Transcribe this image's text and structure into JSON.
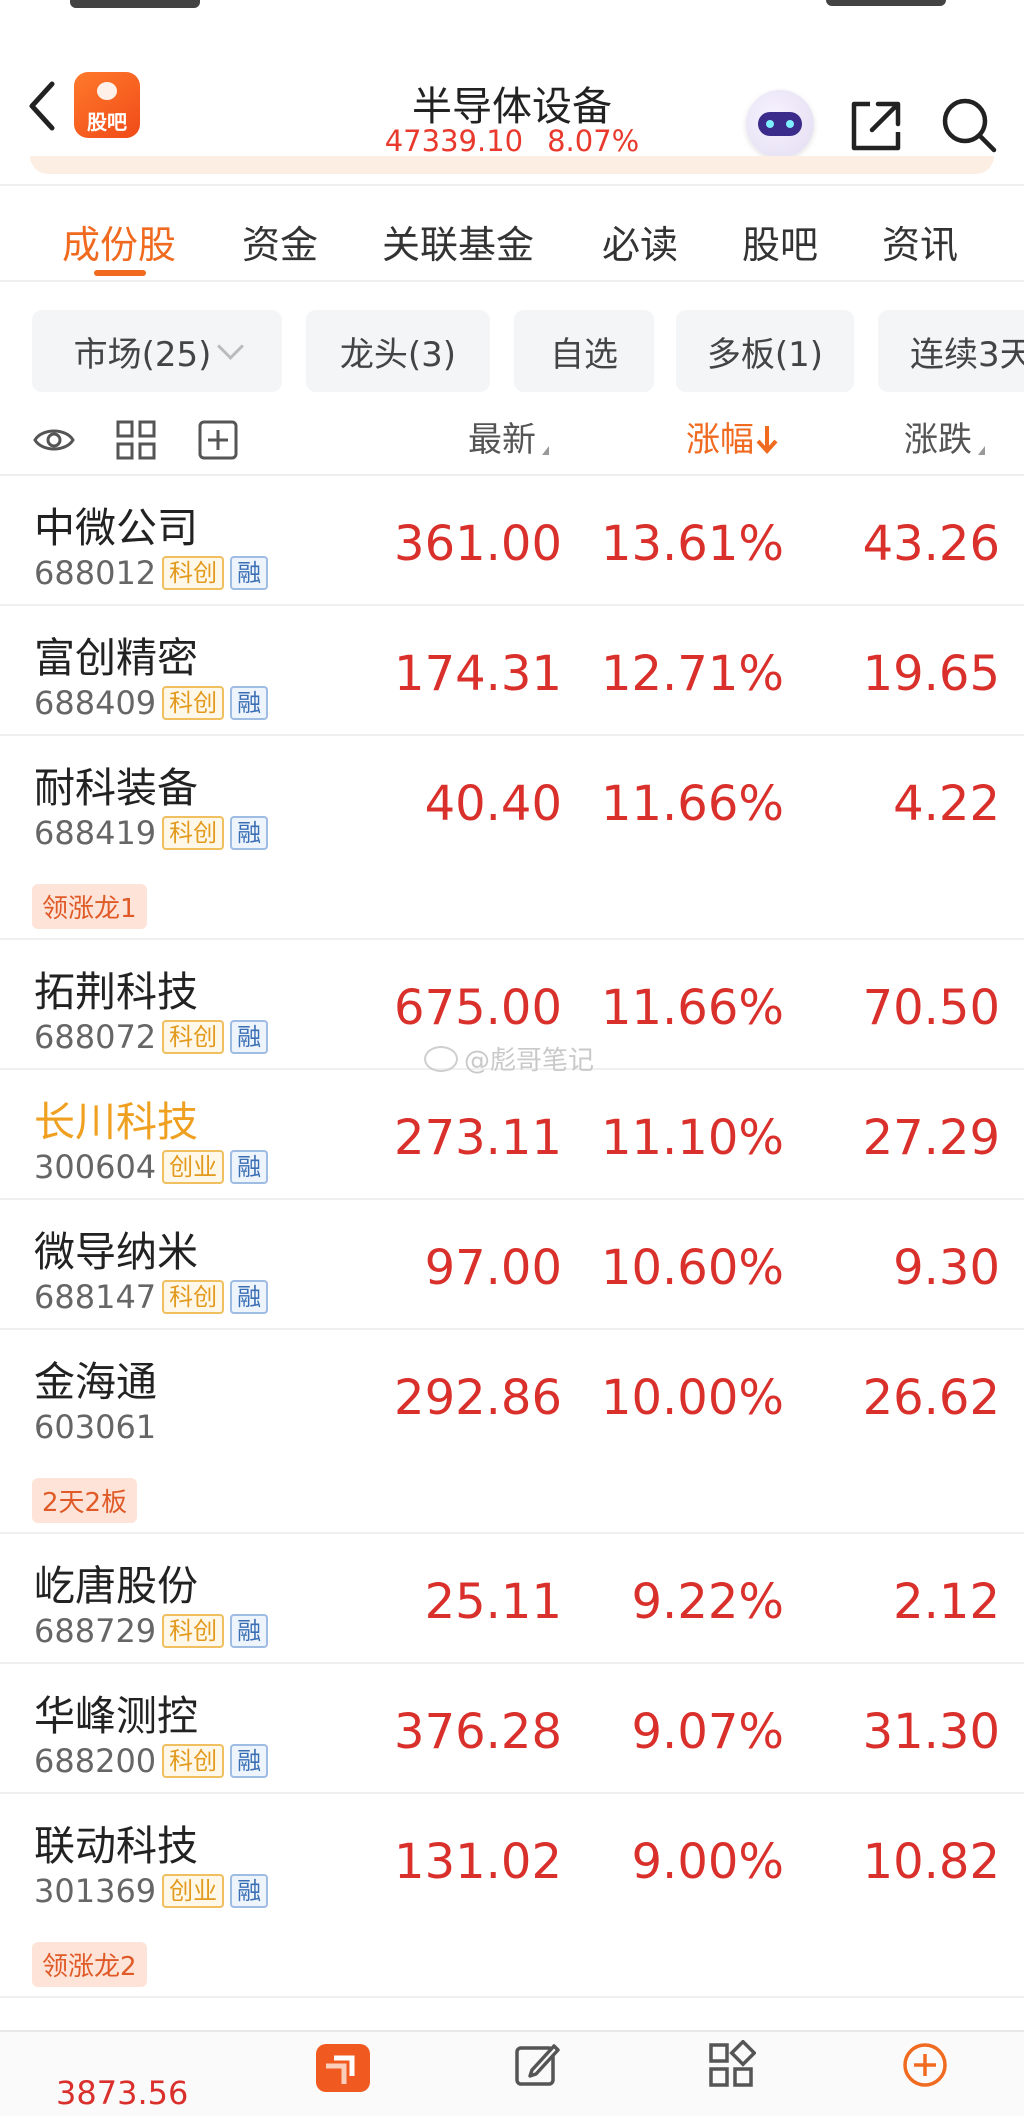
{
  "header": {
    "logo_text": "股吧",
    "title": "半导体设备",
    "index_value": "47339.10",
    "index_change": "8.07%"
  },
  "tabs": [
    {
      "label": "成份股",
      "active": true
    },
    {
      "label": "资金"
    },
    {
      "label": "关联基金"
    },
    {
      "label": "必读"
    },
    {
      "label": "股吧"
    },
    {
      "label": "资讯"
    }
  ],
  "filters": [
    {
      "label": "市场(25)"
    },
    {
      "label": "龙头(3)"
    },
    {
      "label": "自选"
    },
    {
      "label": "多板(1)"
    },
    {
      "label": "连续3天"
    }
  ],
  "columns": {
    "last": "最新",
    "pct": "涨幅",
    "change": "涨跌"
  },
  "stocks": [
    {
      "name": "中微公司",
      "code": "688012",
      "board": "科创",
      "margin": "融",
      "last": "361.00",
      "pct": "13.61%",
      "change": "43.26"
    },
    {
      "name": "富创精密",
      "code": "688409",
      "board": "科创",
      "margin": "融",
      "last": "174.31",
      "pct": "12.71%",
      "change": "19.65"
    },
    {
      "name": "耐科装备",
      "code": "688419",
      "board": "科创",
      "margin": "融",
      "tag": "领涨龙1",
      "last": "40.40",
      "pct": "11.66%",
      "change": "4.22"
    },
    {
      "name": "拓荆科技",
      "code": "688072",
      "board": "科创",
      "margin": "融",
      "last": "675.00",
      "pct": "11.66%",
      "change": "70.50"
    },
    {
      "name": "长川科技",
      "code": "300604",
      "board": "创业",
      "margin": "融",
      "highlight": true,
      "last": "273.11",
      "pct": "11.10%",
      "change": "27.29"
    },
    {
      "name": "微导纳米",
      "code": "688147",
      "board": "科创",
      "margin": "融",
      "last": "97.00",
      "pct": "10.60%",
      "change": "9.30"
    },
    {
      "name": "金海通",
      "code": "603061",
      "tag": "2天2板",
      "last": "292.86",
      "pct": "10.00%",
      "change": "26.62"
    },
    {
      "name": "屹唐股份",
      "code": "688729",
      "board": "科创",
      "margin": "融",
      "last": "25.11",
      "pct": "9.22%",
      "change": "2.12"
    },
    {
      "name": "华峰测控",
      "code": "688200",
      "board": "科创",
      "margin": "融",
      "last": "376.28",
      "pct": "9.07%",
      "change": "31.30"
    },
    {
      "name": "联动科技",
      "code": "301369",
      "board": "创业",
      "margin": "融",
      "tag": "领涨龙2",
      "last": "131.02",
      "pct": "9.00%",
      "change": "10.82"
    }
  ],
  "watermark": "@彪哥笔记",
  "bottom_nav": {
    "index_value": "3873.56"
  },
  "colors": {
    "accent": "#f06a20",
    "up": "#d9302c",
    "highlight_name": "#f0a020"
  }
}
